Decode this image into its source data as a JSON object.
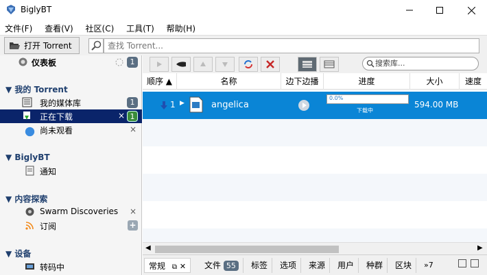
{
  "window": {
    "title": "BiglyBT"
  },
  "menu": [
    "文件(F)",
    "查看(V)",
    "社区(C)",
    "工具(T)",
    "帮助(H)"
  ],
  "toolbar": {
    "open_label": "打开 Torrent",
    "find_placeholder": "查找 Torrent..."
  },
  "sidebar": {
    "dashboard": {
      "label": "仪表板",
      "count": "1"
    },
    "my_torrents": {
      "header": "我的 Torrent",
      "library": {
        "label": "我的媒体库",
        "count": "1"
      },
      "downloading": {
        "label": "正在下载",
        "count": "1"
      },
      "unwatched": {
        "label": "尚未观看"
      }
    },
    "biglybt": {
      "header": "BiglyBT",
      "notifications": "通知"
    },
    "discovery": {
      "header": "内容探索",
      "swarm": "Swarm Discoveries",
      "subscriptions": "订阅"
    },
    "devices": {
      "header": "设备",
      "transcoding": "转码中"
    }
  },
  "library": {
    "search_placeholder": "搜索库...",
    "columns": [
      "顺序",
      "名称",
      "边下边播",
      "进度",
      "大小",
      "速度"
    ],
    "torrent": {
      "order": "1",
      "name": "angelica",
      "progress": "0.0%",
      "progress_value": 0.0,
      "status": "下载中",
      "size": "594.00 MB"
    }
  },
  "tabs": {
    "general": "常规",
    "files": "文件",
    "files_count": "55",
    "tags": "标签",
    "options": "选项",
    "sources": "来源",
    "users": "用户",
    "swarm": "种群",
    "pieces": "区块",
    "more": "»7"
  },
  "colors": {
    "selection": "#0a85d6",
    "sidebar_selected": "#0a246a",
    "header": "#1f3f6e",
    "accent_green": "#3a8c3a"
  }
}
